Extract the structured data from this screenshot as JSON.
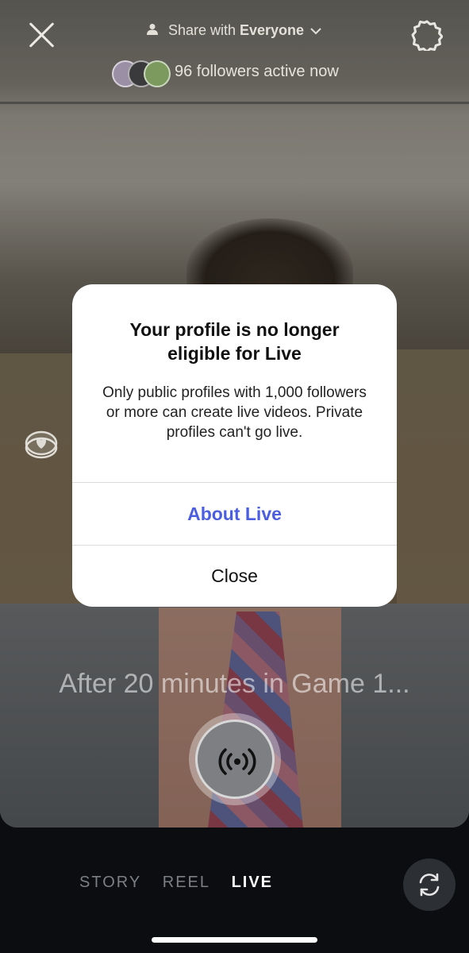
{
  "header": {
    "share_prefix": "Share with",
    "share_audience": "Everyone",
    "followers_active": "96 followers active now"
  },
  "caption": "After 20 minutes in Game 1...",
  "modal": {
    "title": "Your profile is no longer eligible for Live",
    "body": "Only public profiles with 1,000 followers or more can create live videos. Private profiles can't go live.",
    "primary_button": "About Live",
    "secondary_button": "Close"
  },
  "modes": [
    "STORY",
    "REEL",
    "LIVE"
  ],
  "active_mode": "LIVE",
  "colors": {
    "accent": "#4b5ee0"
  },
  "icons": [
    "close-icon",
    "person-icon",
    "chevron-down-icon",
    "gear-icon",
    "follower-avatars",
    "heart-badge-icon",
    "live-broadcast-icon",
    "camera-flip-icon"
  ]
}
